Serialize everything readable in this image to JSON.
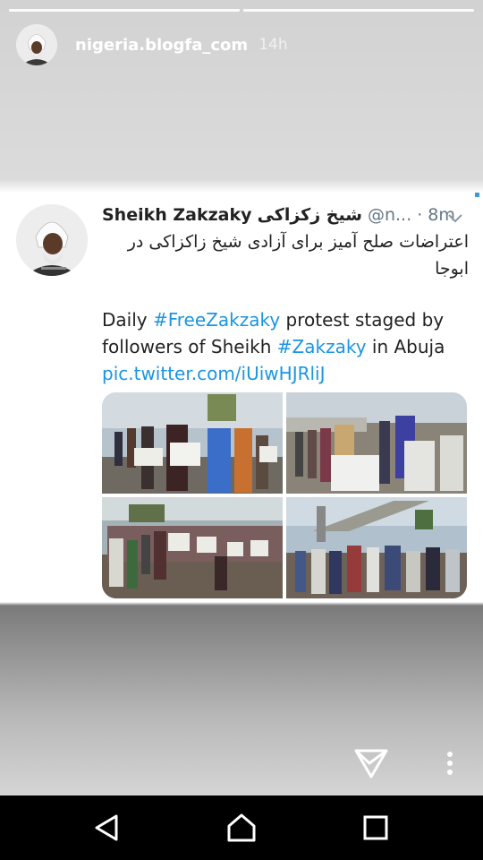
{
  "story": {
    "username": "nigeria.blogfa_com",
    "time": "14h",
    "progress_segments": 2
  },
  "tweet": {
    "display_name": "Sheikh Zakzaky",
    "display_name_fa": "شیخ زکزاکی",
    "handle": "@n...",
    "separator": "·",
    "time": "8m",
    "persian_text": "اعتراضات صلح آمیز برای آزادی شیخ زاکزاکی در ابوجا",
    "text_1": "Daily ",
    "hashtag_1": "#FreeZakzaky",
    "text_2": " protest staged by followers of Sheikh ",
    "hashtag_2": "#Zakzaky",
    "text_3": " in Abuja",
    "link": "pic.twitter.com/iUiwHJRliJ"
  },
  "actions": {
    "share_icon": "paper-plane-icon",
    "more_icon": "more-vertical-icon"
  },
  "navbar": {
    "back_icon": "triangle-back-icon",
    "home_icon": "home-icon",
    "recents_icon": "square-recents-icon"
  }
}
